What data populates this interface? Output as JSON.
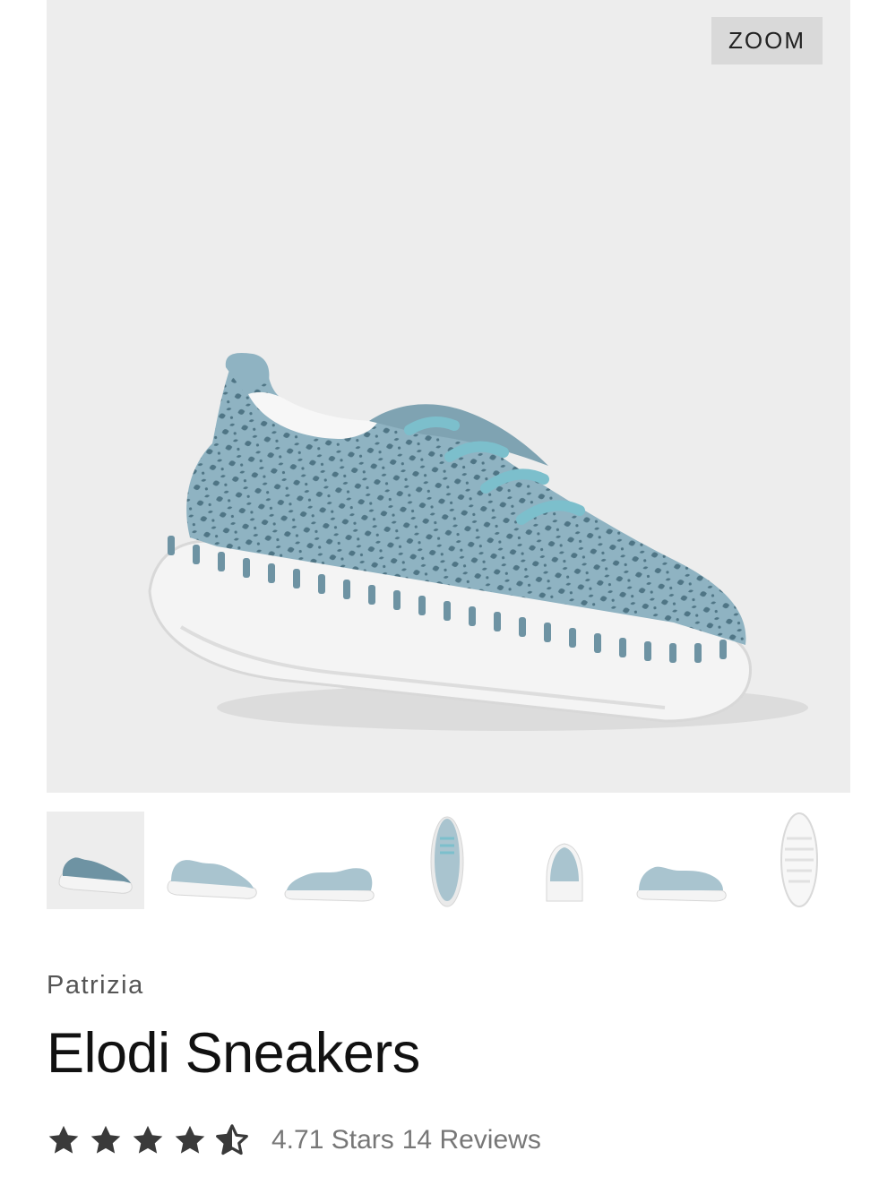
{
  "gallery": {
    "zoom_label": "ZOOM",
    "thumbnails": [
      {
        "view": "three-quarter",
        "active": true
      },
      {
        "view": "side-left",
        "active": false
      },
      {
        "view": "side-right",
        "active": false
      },
      {
        "view": "top",
        "active": false
      },
      {
        "view": "back",
        "active": false
      },
      {
        "view": "side-inner",
        "active": false
      },
      {
        "view": "sole",
        "active": false
      }
    ],
    "colors": {
      "background": "#ededed",
      "upper": "#8fb3c2",
      "upper_dark": "#6e93a3",
      "sole": "#f3f3f3"
    }
  },
  "product": {
    "brand": "Patrizia",
    "name": "Elodi Sneakers"
  },
  "rating": {
    "value": 4.71,
    "max": 5,
    "stars_label": "4.71 Stars",
    "reviews_label": "14 Reviews",
    "star_color": "#3a3a3a"
  }
}
